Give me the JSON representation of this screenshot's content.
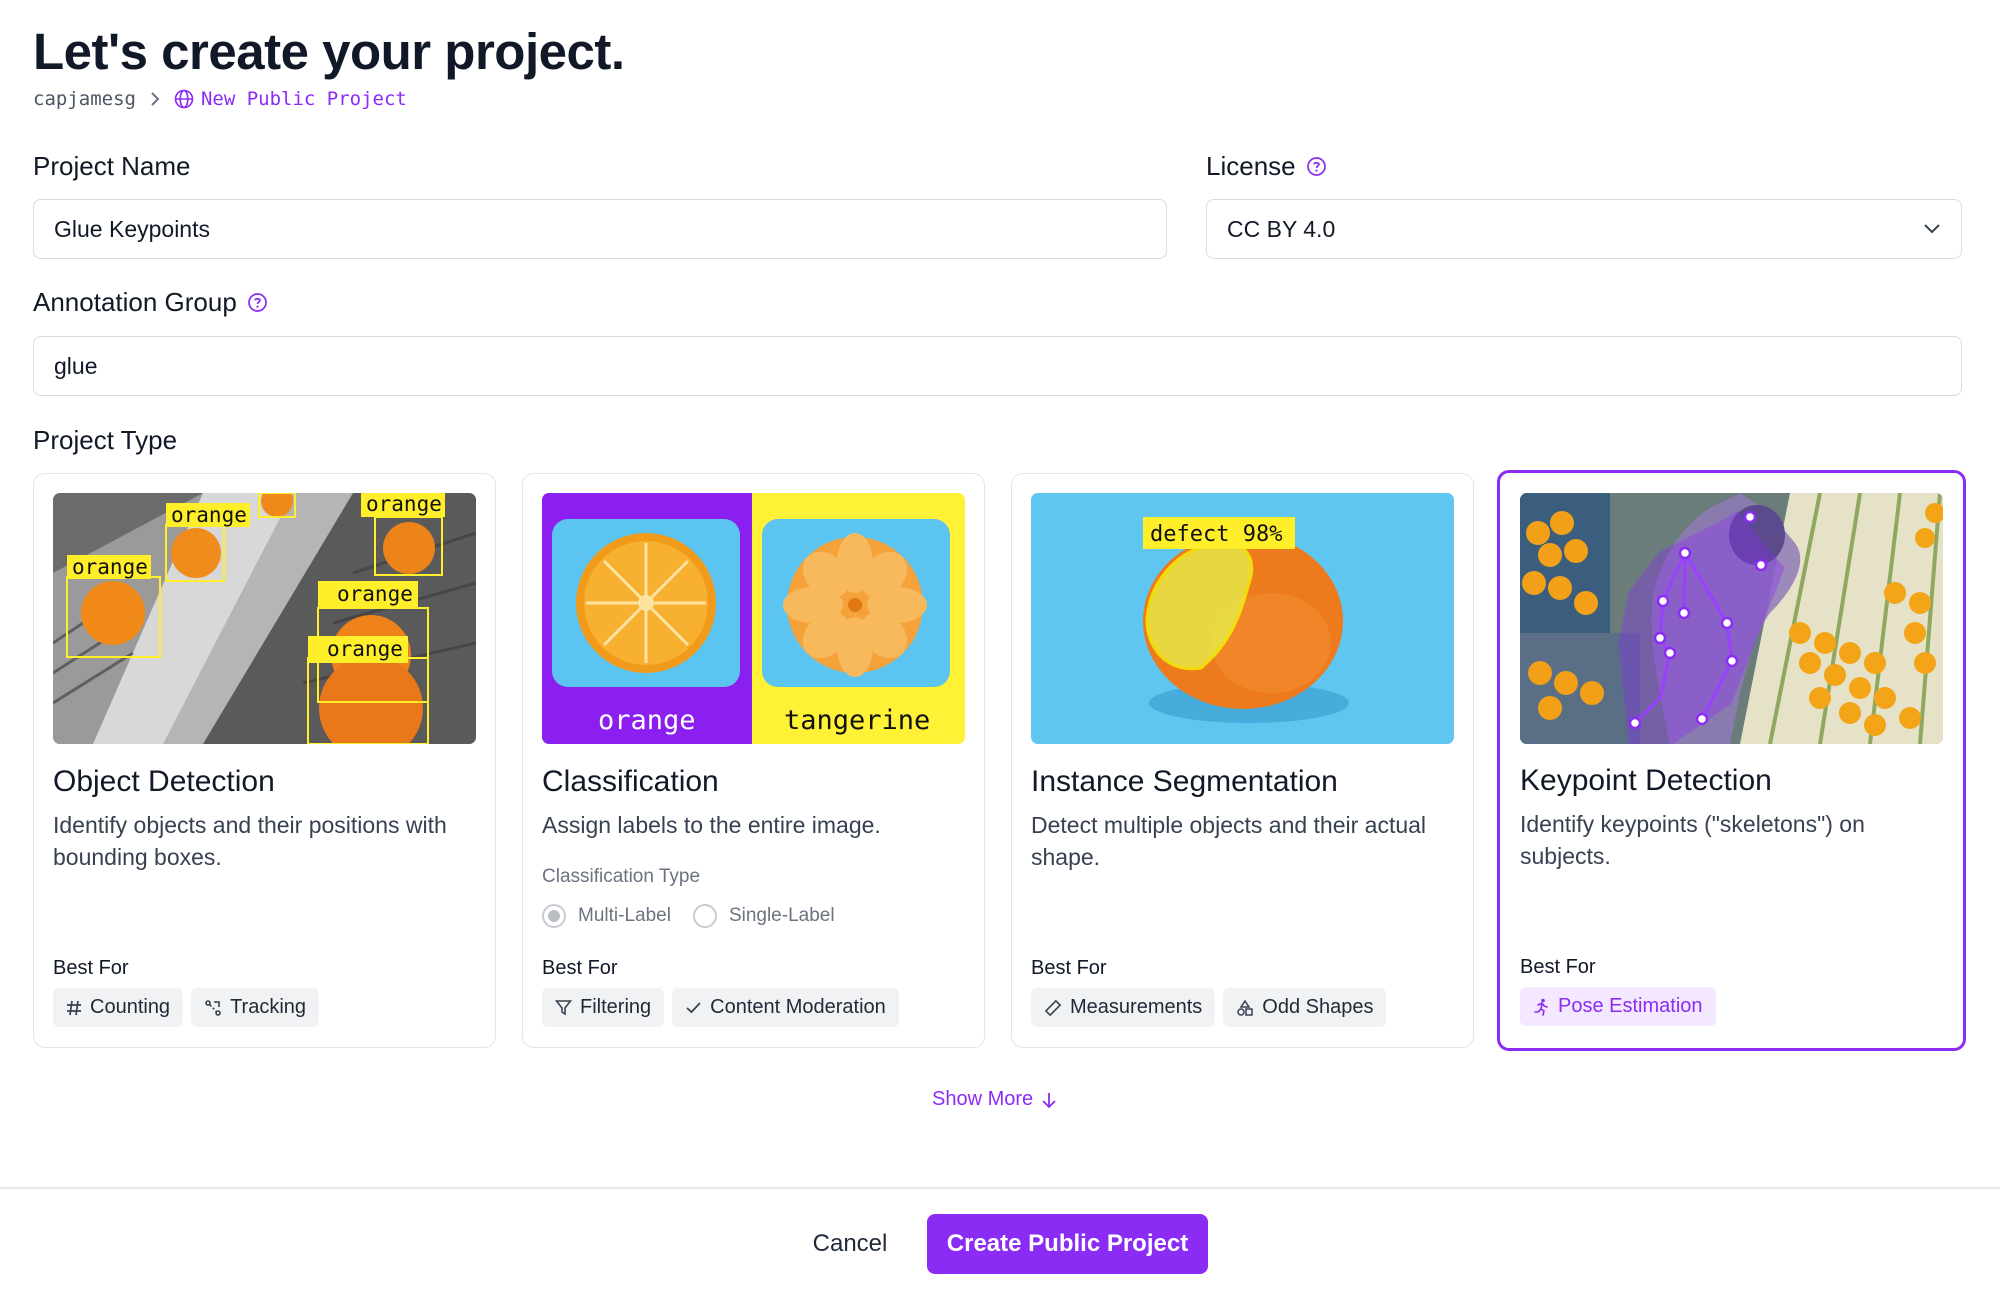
{
  "header": {
    "title": "Let's create your project.",
    "breadcrumb_user": "capjamesg",
    "breadcrumb_current": "New Public Project"
  },
  "form": {
    "project_name_label": "Project Name",
    "project_name_value": "Glue Keypoints",
    "license_label": "License",
    "license_value": "CC BY 4.0",
    "annotation_group_label": "Annotation Group",
    "annotation_group_value": "glue",
    "project_type_label": "Project Type"
  },
  "cards": [
    {
      "title": "Object Detection",
      "description": "Identify objects and their positions with bounding boxes.",
      "best_for_label": "Best For",
      "tags": [
        "Counting",
        "Tracking"
      ],
      "image_labels": [
        "orange",
        "orange",
        "orange",
        "orange",
        "orange"
      ]
    },
    {
      "title": "Classification",
      "description": "Assign labels to the entire image.",
      "classification_type_label": "Classification Type",
      "radio_options": [
        "Multi-Label",
        "Single-Label"
      ],
      "best_for_label": "Best For",
      "tags": [
        "Filtering",
        "Content Moderation"
      ],
      "image_labels": [
        "orange",
        "tangerine"
      ]
    },
    {
      "title": "Instance Segmentation",
      "description": "Detect multiple objects and their actual shape.",
      "best_for_label": "Best For",
      "tags": [
        "Measurements",
        "Odd Shapes"
      ],
      "image_labels": [
        "defect 98%"
      ]
    },
    {
      "title": "Keypoint Detection",
      "description": "Identify keypoints (\"skeletons\") on subjects.",
      "best_for_label": "Best For",
      "tags": [
        "Pose Estimation"
      ],
      "selected": true
    }
  ],
  "show_more": "Show More",
  "footer": {
    "cancel": "Cancel",
    "create": "Create Public Project"
  },
  "colors": {
    "accent": "#8b2cf5",
    "tag_bg": "#f1f2f4",
    "tag_selected_bg": "#f3e8ff"
  }
}
